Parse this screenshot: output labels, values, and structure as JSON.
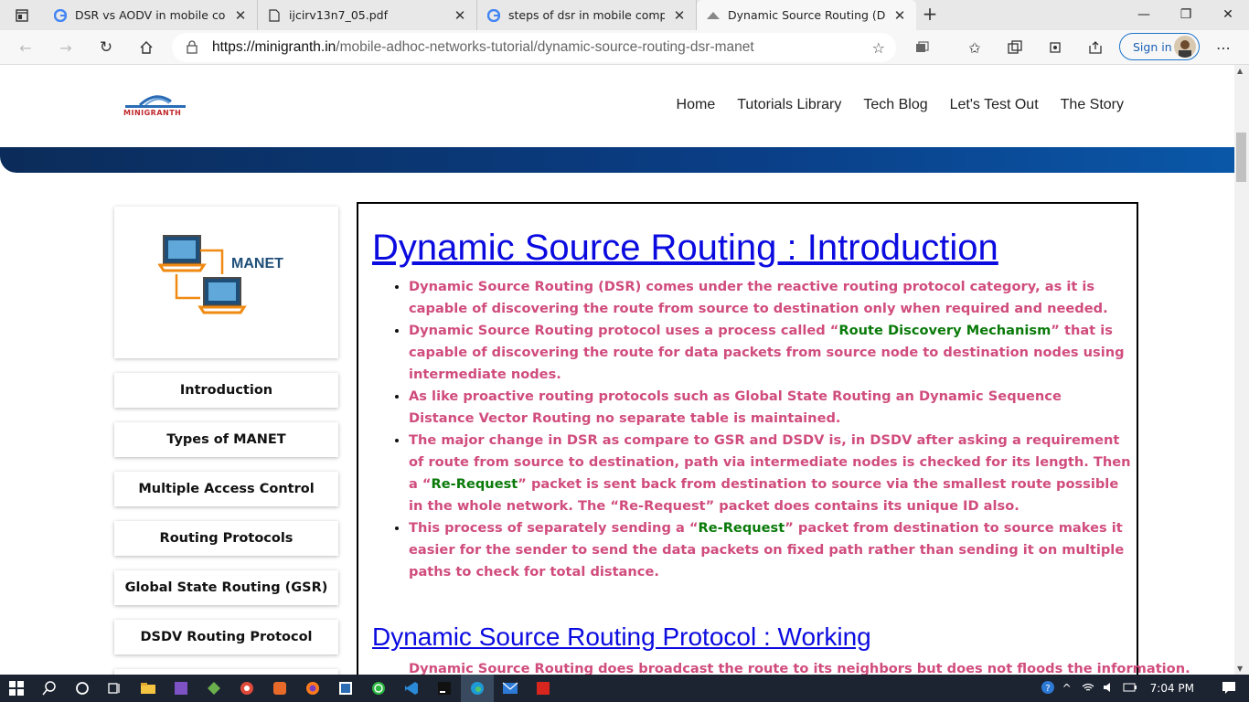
{
  "browser": {
    "tabs": [
      {
        "title": "DSR vs AODV in mobile computing",
        "icon": "google-icon",
        "active": false
      },
      {
        "title": "ijcirv13n7_05.pdf",
        "icon": "document-icon",
        "active": false
      },
      {
        "title": "steps of dsr in mobile computing",
        "icon": "google-icon",
        "active": false
      },
      {
        "title": "Dynamic Source Routing (DSR) |",
        "icon": "site-icon",
        "active": true
      }
    ],
    "url_host": "https://minigranth.in",
    "url_path": "/mobile-adhoc-networks-tutorial/dynamic-source-routing-dsr-manet",
    "signin_label": "Sign in"
  },
  "site": {
    "nav": [
      "Home",
      "Tutorials Library",
      "Tech Blog",
      "Let's Test Out",
      "The Story"
    ],
    "logo_text": "MINIGRANTH",
    "manet_label": "MANET",
    "band_color": "#0a3e86"
  },
  "sidebar": [
    "Introduction",
    "Types of MANET",
    "Multiple Access Control",
    "Routing Protocols",
    "Global State Routing (GSR)",
    "DSDV Routing Protocol"
  ],
  "article": {
    "h1": "Dynamic Source Routing : Introduction",
    "bullets": [
      {
        "parts": [
          {
            "t": "Dynamic Source Routing (DSR) comes under the reactive routing protocol category, as it is capable of discovering the route from source to destination only when required and needed.",
            "g": false
          }
        ]
      },
      {
        "parts": [
          {
            "t": "Dynamic Source Routing protocol uses a process called “",
            "g": false
          },
          {
            "t": "Route Discovery Mechanism",
            "g": true
          },
          {
            "t": "” that is capable of discovering the route for data packets from source node to destination nodes using intermediate nodes.",
            "g": false
          }
        ]
      },
      {
        "parts": [
          {
            "t": "As like proactive routing protocols such as Global State Routing an Dynamic Sequence Distance Vector Routing no separate table is maintained.",
            "g": false
          }
        ]
      },
      {
        "parts": [
          {
            "t": "The major change in DSR as compare to GSR and DSDV is, in DSDV after asking a requirement of route from source to destination, path via intermediate nodes is checked for its length. Then a “",
            "g": false
          },
          {
            "t": "Re-Request",
            "g": true
          },
          {
            "t": "” packet is sent back from destination to source via the smallest route possible in the whole network. The “Re-Request” packet does contains its unique ID also.",
            "g": false
          }
        ]
      },
      {
        "parts": [
          {
            "t": "This process of separately sending a “",
            "g": false
          },
          {
            "t": "Re-Request",
            "g": true
          },
          {
            "t": "” packet from destination to source makes it easier for the sender to send the data packets on fixed path rather than sending it on multiple paths to check for total distance.",
            "g": false
          }
        ]
      }
    ],
    "h2": "Dynamic Source Routing Protocol : Working",
    "cut_text": "Dynamic Source Routing does broadcast the route to its neighbors but does not floods the information."
  },
  "taskbar": {
    "time": "7:04 PM"
  }
}
